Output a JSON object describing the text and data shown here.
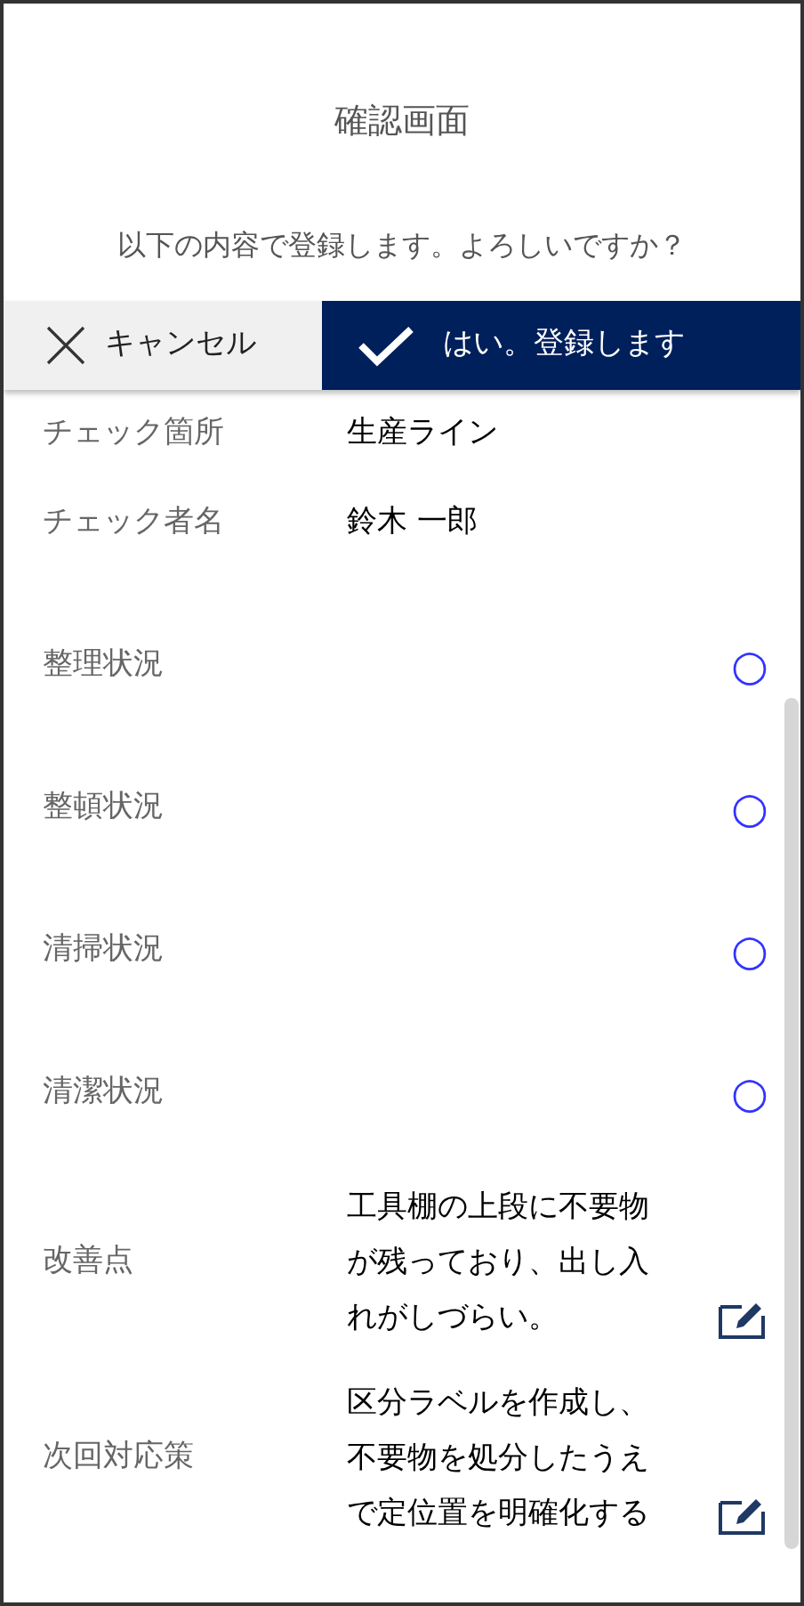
{
  "title": "確認画面",
  "message": "以下の内容で登録します。よろしいですか？",
  "buttons": [
    {
      "kind": "cancel",
      "label": "キャンセル"
    },
    {
      "kind": "confirm",
      "label": "はい。登録します"
    }
  ],
  "fields": [
    {
      "kind": "text",
      "label": "チェック箇所",
      "value": "生産ライン"
    },
    {
      "kind": "text",
      "label": "チェック者名",
      "value": "鈴木 一郎"
    },
    {
      "kind": "mark",
      "label": "整理状況",
      "value": "○"
    },
    {
      "kind": "mark",
      "label": "整頓状況",
      "value": "○"
    },
    {
      "kind": "mark",
      "label": "清掃状況",
      "value": "○"
    },
    {
      "kind": "mark",
      "label": "清潔状況",
      "value": "○"
    },
    {
      "kind": "note",
      "label": "改善点",
      "value": "工具棚の上段に不要物が残っており、出し入れがしづらい。"
    },
    {
      "kind": "note",
      "label": "次回対応策",
      "value": "区分ラベルを作成し、不要物を処分したうえで定位置を明確化する"
    }
  ]
}
